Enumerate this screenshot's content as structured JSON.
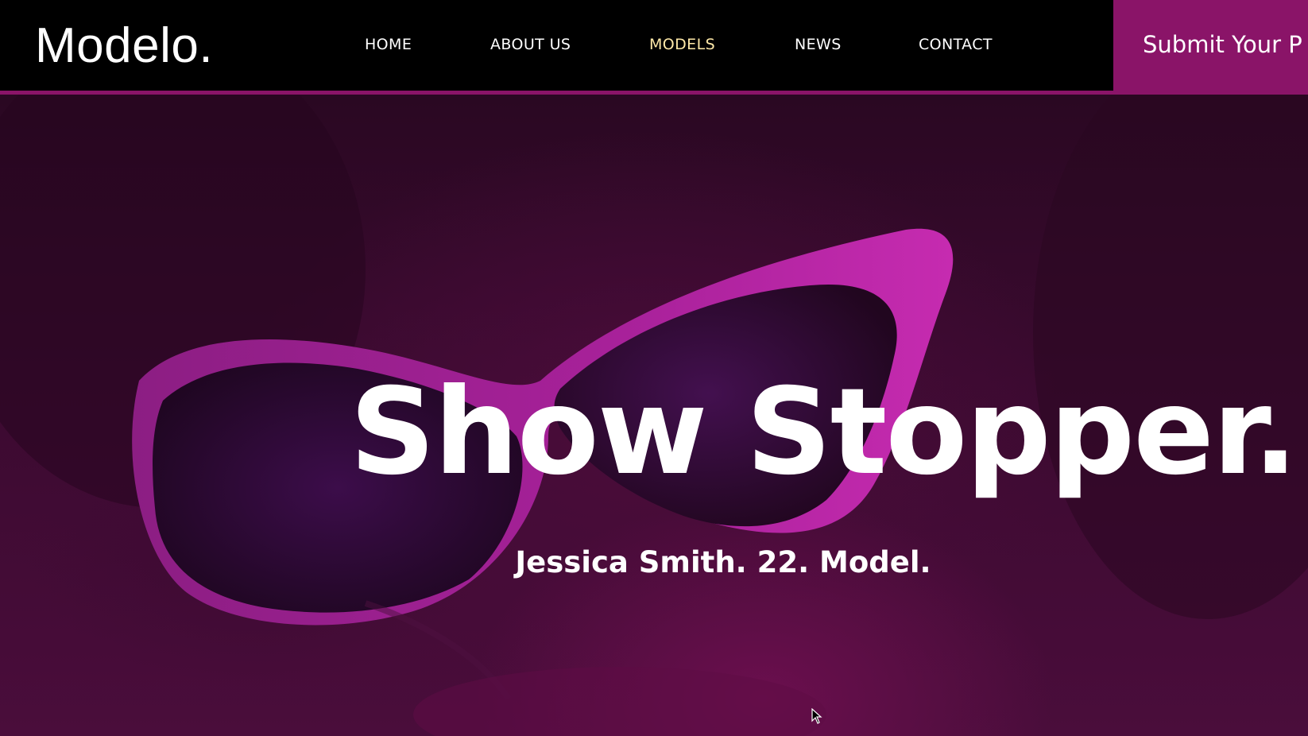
{
  "brand": {
    "logo_text": "Modelo."
  },
  "nav": {
    "items": [
      {
        "label": "HOME"
      },
      {
        "label": "ABOUT US"
      },
      {
        "label": "MODELS",
        "active": true
      },
      {
        "label": "NEWS"
      },
      {
        "label": "CONTACT"
      }
    ],
    "cta_label": "Submit Your P"
  },
  "hero": {
    "title": "Show Stopper.",
    "subtitle": "Jessica Smith. 22. Model."
  },
  "colors": {
    "accent": "#8a1468",
    "header_bg": "#000000",
    "active_nav": "#ffe9a8",
    "text": "#ffffff",
    "hero_tint": "#4a0d3b"
  },
  "icons": {
    "cursor": "mouse-pointer-icon"
  }
}
